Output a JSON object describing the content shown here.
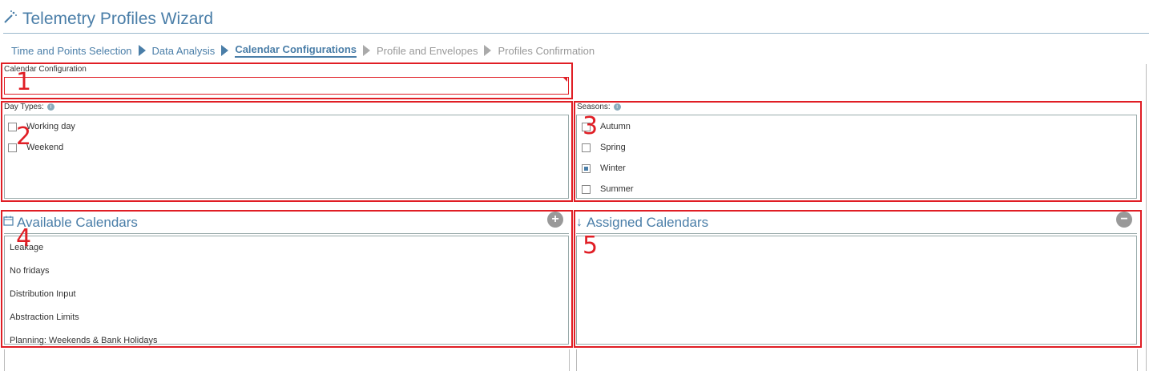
{
  "window": {
    "title": "Telemetry Profiles Wizard"
  },
  "breadcrumbs": [
    {
      "label": "Time and Points Selection",
      "state": "done"
    },
    {
      "label": "Data Analysis",
      "state": "done"
    },
    {
      "label": "Calendar Configurations",
      "state": "active"
    },
    {
      "label": "Profile and Envelopes",
      "state": "pending"
    },
    {
      "label": "Profiles Confirmation",
      "state": "pending"
    }
  ],
  "calendar_configuration": {
    "label": "Calendar Configuration",
    "value": ""
  },
  "day_types": {
    "label": "Day Types:",
    "items": [
      {
        "label": "Working day",
        "checked": false
      },
      {
        "label": "Weekend",
        "checked": false
      }
    ]
  },
  "seasons": {
    "label": "Seasons:",
    "items": [
      {
        "label": "Autumn",
        "checked": false
      },
      {
        "label": "Spring",
        "checked": false
      },
      {
        "label": "Winter",
        "checked": true
      },
      {
        "label": "Summer",
        "checked": false
      }
    ]
  },
  "available_calendars": {
    "title": "Available Calendars",
    "items": [
      "Leakage",
      "No fridays",
      "Distribution Input",
      "Abstraction Limits",
      "Planning: Weekends & Bank Holidays"
    ]
  },
  "assigned_calendars": {
    "title": "Assigned Calendars",
    "items": []
  },
  "annotations": [
    "1",
    "2",
    "3",
    "4",
    "5"
  ],
  "colors": {
    "accent": "#4a7ea8",
    "annotation": "#e01e25"
  }
}
